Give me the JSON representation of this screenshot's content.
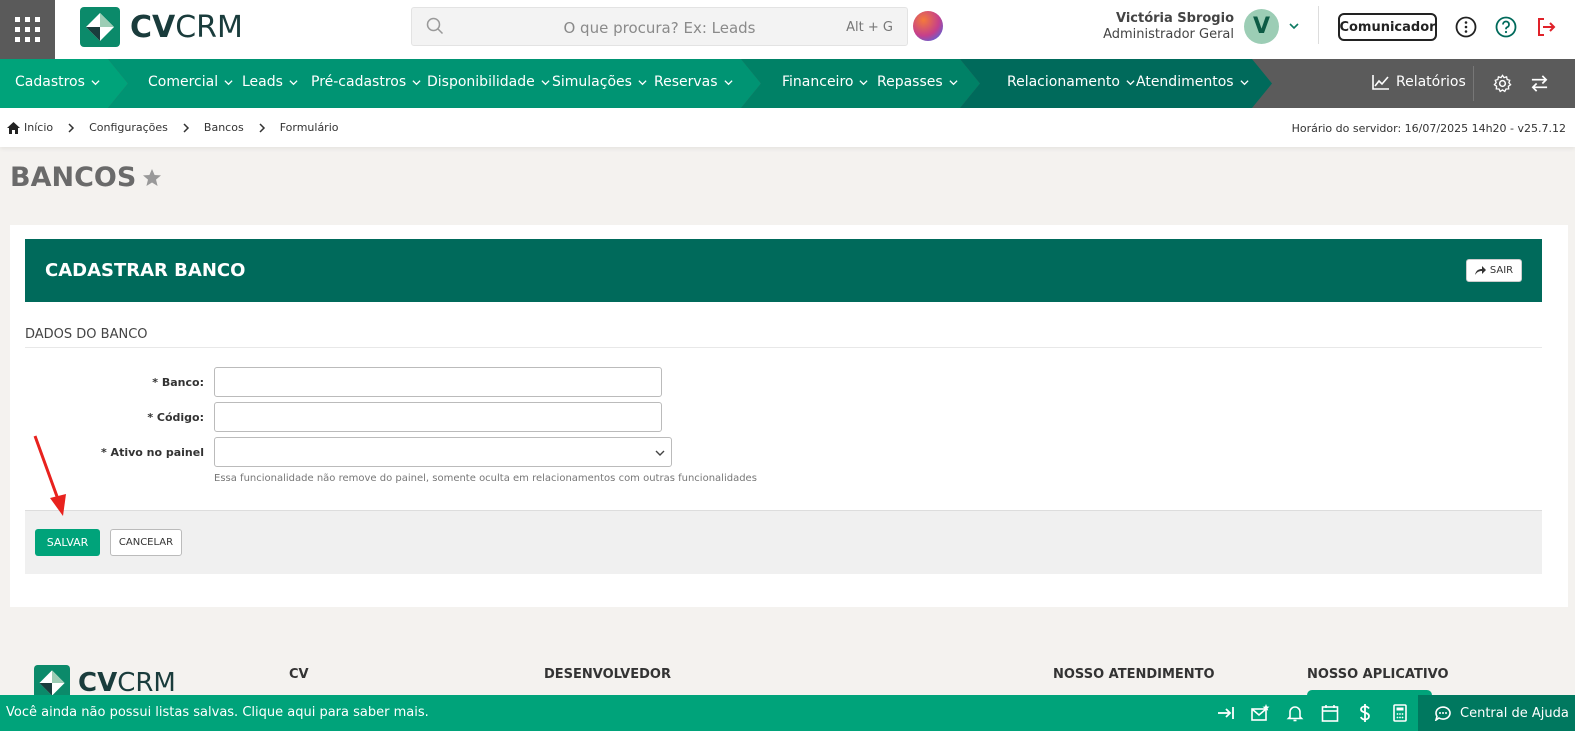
{
  "header": {
    "logo_text_bold": "CV",
    "logo_text_light": "CRM",
    "search_placeholder": "O que procura? Ex: Leads",
    "search_shortcut": "Alt + G",
    "user_name": "Victória Sbrogio",
    "user_role": "Administrador Geral",
    "avatar_letter": "V",
    "comunicador_label": "Comunicador"
  },
  "nav": {
    "items": [
      {
        "label": "Cadastros"
      },
      {
        "label": "Comercial"
      },
      {
        "label": "Leads"
      },
      {
        "label": "Pré-cadastros"
      },
      {
        "label": "Disponibilidade"
      },
      {
        "label": "Simulações"
      },
      {
        "label": "Reservas"
      },
      {
        "label": "Financeiro"
      },
      {
        "label": "Repasses"
      },
      {
        "label": "Relacionamento"
      },
      {
        "label": "Atendimentos"
      }
    ],
    "reports_label": "Relatórios"
  },
  "breadcrumb": {
    "items": [
      "Início",
      "Configurações",
      "Bancos",
      "Formulário"
    ],
    "server_time": "Horário do servidor: 16/07/2025 14h20 - v25.7.12"
  },
  "page": {
    "title": "BANCOS"
  },
  "form": {
    "header_title": "CADASTRAR BANCO",
    "exit_label": "SAIR",
    "section_title": "DADOS DO BANCO",
    "fields": [
      {
        "label": "* Banco:",
        "value": ""
      },
      {
        "label": "* Código:",
        "value": ""
      },
      {
        "label": "* Ativo no painel",
        "value": ""
      }
    ],
    "hint": "Essa funcionalidade não remove do painel, somente oculta em relacionamentos com outras funcionalidades",
    "save_label": "SALVAR",
    "cancel_label": "CANCELAR"
  },
  "site_footer": {
    "columns": [
      "CV",
      "DESENVOLVEDOR",
      "NOSSO ATENDIMENTO",
      "NOSSO APLICATIVO"
    ]
  },
  "bottom_bar": {
    "message": "Você ainda não possui listas salvas. Clique aqui para saber mais.",
    "help_label": "Central de Ajuda"
  },
  "colors": {
    "brand_green": "#00a37a",
    "dark_teal": "#006a5b",
    "nav_gray": "#5b5b5b"
  }
}
